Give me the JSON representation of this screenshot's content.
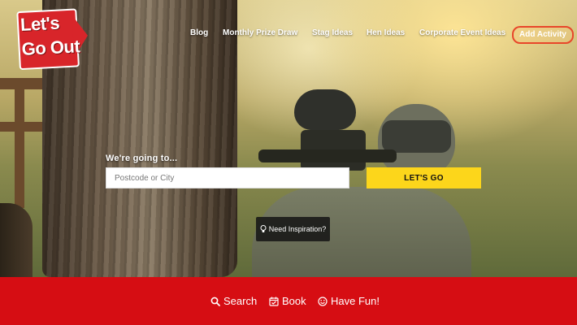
{
  "logo": {
    "line1": "Let's",
    "line2": "Go Out"
  },
  "nav": {
    "items": [
      {
        "label": "Blog"
      },
      {
        "label": "Monthly Prize Draw"
      },
      {
        "label": "Stag Ideas"
      },
      {
        "label": "Hen Ideas"
      },
      {
        "label": "Corporate Event Ideas"
      }
    ],
    "cta": "Add Activity"
  },
  "hero": {
    "heading": "We're going to...",
    "search_placeholder": "Postcode or City",
    "search_value": "",
    "button": "LET'S GO",
    "inspiration": "Need Inspiration?"
  },
  "footer_bar": {
    "items": [
      {
        "label": "Search",
        "icon": "search-icon"
      },
      {
        "label": "Book",
        "icon": "calendar-check-icon"
      },
      {
        "label": "Have Fun!",
        "icon": "smiley-icon"
      }
    ]
  },
  "colors": {
    "brand_red": "#d60d13",
    "cta_yellow": "#fcd61b",
    "add_border": "#e8462a"
  }
}
